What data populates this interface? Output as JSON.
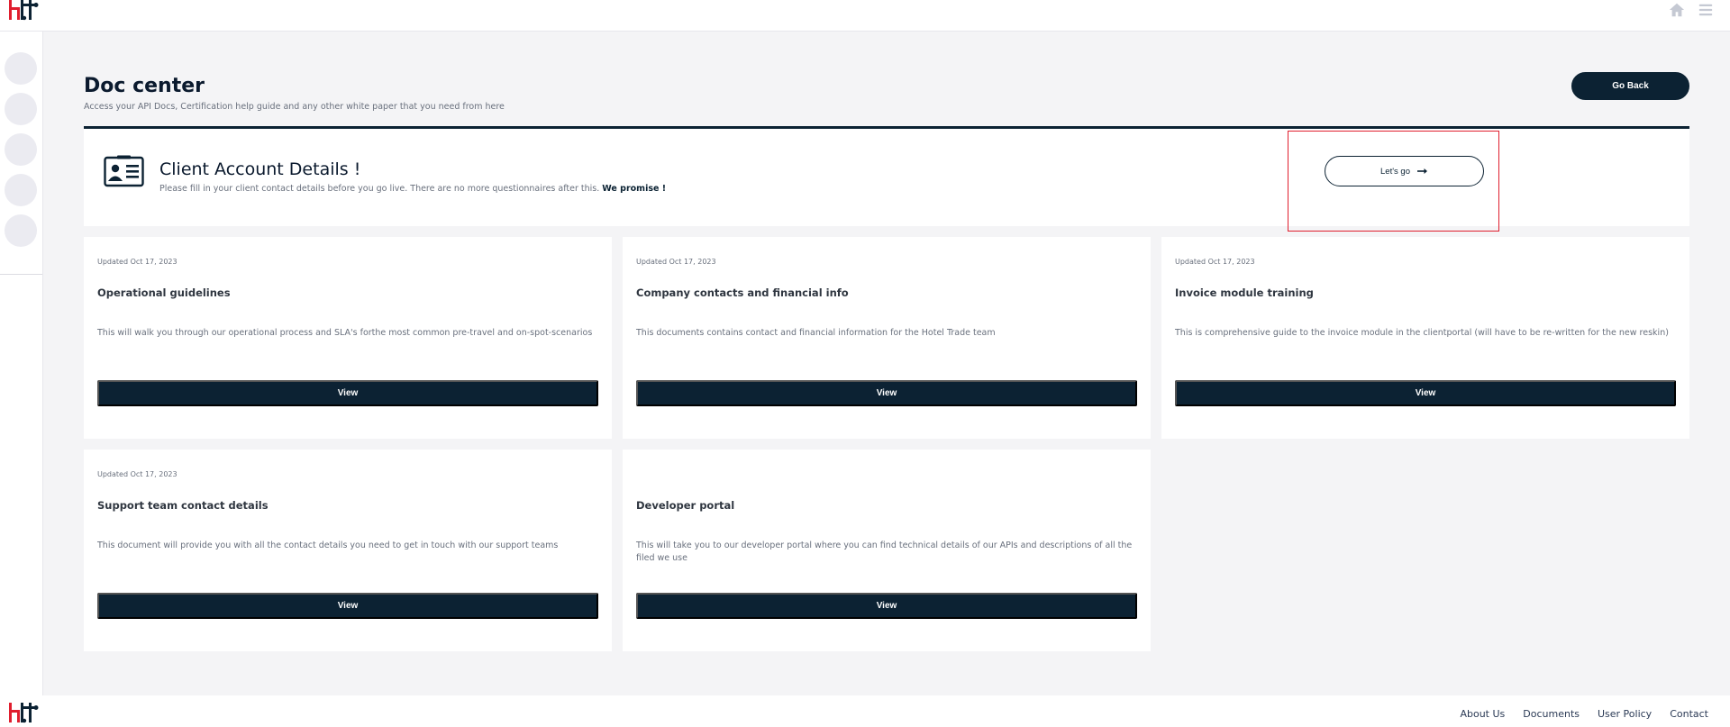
{
  "header": {
    "logo": "hotel-trade-logo",
    "icons": [
      "home-icon",
      "menu-icon"
    ]
  },
  "sidebar": {
    "items": [
      "sidebar-item-1",
      "sidebar-item-2",
      "sidebar-item-3",
      "sidebar-item-4",
      "sidebar-item-5"
    ]
  },
  "page": {
    "title": "Doc center",
    "subtitle": "Access your API Docs, Certification help guide and any other white paper that you need from here",
    "go_back_label": "Go Back"
  },
  "account": {
    "title": "Client Account Details !",
    "subtitle": "Please fill in your client contact details before you go live. There are no more questionnaires after this.",
    "subtitle_bold": "We promise !",
    "cta_label": "Let's go",
    "cta_icon": "arrow-right-icon"
  },
  "documents": [
    {
      "updated": "Updated Oct 17, 2023",
      "title": "Operational guidelines",
      "description": "This will walk you through our operational process and SLA's forthe most common pre-travel and on-spot-scenarios",
      "button": "View"
    },
    {
      "updated": "Updated Oct 17, 2023",
      "title": "Company contacts and financial info",
      "description": "This documents contains contact and financial information for the Hotel Trade team",
      "button": "View"
    },
    {
      "updated": "Updated Oct 17, 2023",
      "title": "Invoice module training",
      "description": "This is comprehensive guide to the invoice module in the clientportal (will have to be re-written for the new reskin)",
      "button": "View"
    },
    {
      "updated": "Updated Oct 17, 2023",
      "title": "Support team contact details",
      "description": "This document will provide you with all the contact details you need to get in touch with our support teams",
      "button": "View"
    },
    {
      "updated": "",
      "title": "Developer portal",
      "description": "This will take you to our developer portal where you can find technical details of our APIs and descriptions of all the filed we use",
      "button": "View"
    }
  ],
  "footer": {
    "links": [
      "About Us",
      "Documents",
      "User Policy",
      "Contact"
    ]
  },
  "colors": {
    "primary": "#0c2233",
    "highlight": "#e01e2e",
    "background": "#f4f4f6",
    "logo_red": "#e01e2e"
  }
}
